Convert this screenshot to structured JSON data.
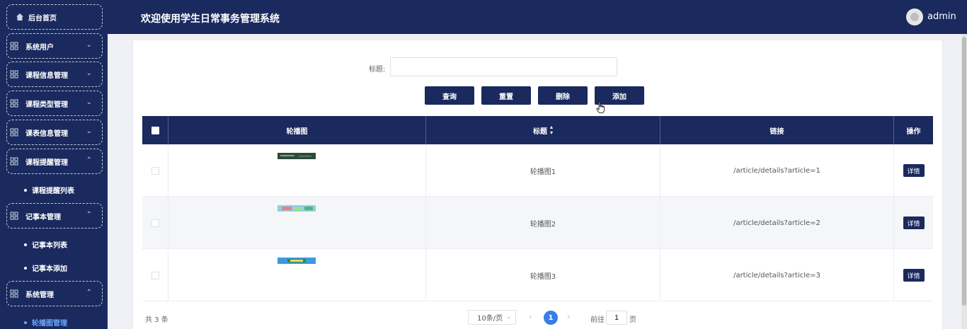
{
  "header": {
    "title": "欢迎使用学生日常事务管理系统",
    "user": "admin"
  },
  "sidebar": {
    "home": "后台首页",
    "menus": [
      {
        "label": "系统用户",
        "expanded": false
      },
      {
        "label": "课程信息管理",
        "expanded": false
      },
      {
        "label": "课程类型管理",
        "expanded": false
      },
      {
        "label": "课表信息管理",
        "expanded": false
      },
      {
        "label": "课程提醒管理",
        "expanded": true
      },
      {
        "label": "记事本管理",
        "expanded": true
      },
      {
        "label": "系统管理",
        "expanded": true
      }
    ],
    "subitems": {
      "course_reminder_list": "课程提醒列表",
      "notebook_list": "记事本列表",
      "notebook_add": "记事本添加",
      "carousel_manage": "轮播图管理"
    },
    "arrow_down": "⌄",
    "arrow_up": "⌃"
  },
  "search": {
    "label": "标题:",
    "value": "",
    "placeholder": ""
  },
  "buttons": {
    "query": "查询",
    "reset": "重置",
    "delete": "删除",
    "add": "添加"
  },
  "table": {
    "columns": {
      "image": "轮播图",
      "title": "标题",
      "link": "链接",
      "action": "操作"
    },
    "rows": [
      {
        "title": "轮播图1",
        "link": "/article/details?article=1",
        "action": "详情"
      },
      {
        "title": "轮播图2",
        "link": "/article/details?article=2",
        "action": "详情"
      },
      {
        "title": "轮播图3",
        "link": "/article/details?article=3",
        "action": "详情"
      }
    ]
  },
  "pagination": {
    "total": "共 3 条",
    "page_size": "10条/页",
    "prev": "‹",
    "next": "›",
    "current_page": "1",
    "goto_label": "前往",
    "goto_value": "1",
    "goto_unit": "页"
  },
  "colors": {
    "navy": "#1a2a5e",
    "active_page": "#3a7de8",
    "active_link": "#6aa8ff"
  }
}
